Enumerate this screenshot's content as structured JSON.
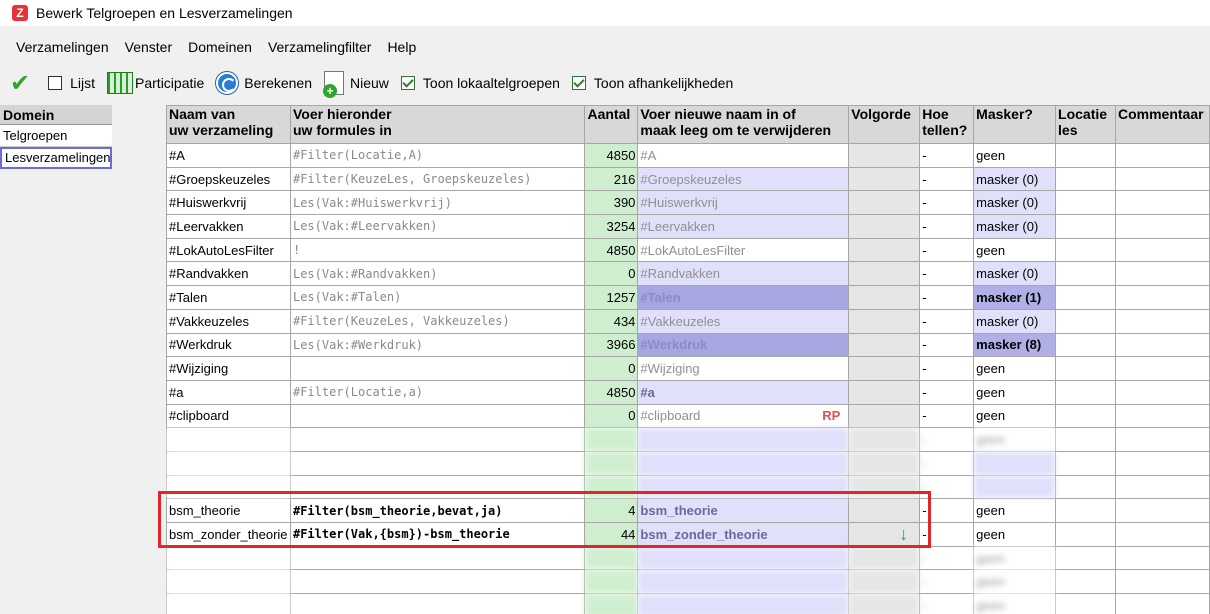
{
  "window": {
    "title": "Bewerk Telgroepen en Lesverzamelingen"
  },
  "menu": [
    "Verzamelingen",
    "Venster",
    "Domeinen",
    "Verzamelingfilter",
    "Help"
  ],
  "toolbar": {
    "lijst": "Lijst",
    "participatie": "Participatie",
    "berekenen": "Berekenen",
    "nieuw": "Nieuw",
    "toon_lokaal": "Toon lokaaltelgroepen",
    "toon_afh": "Toon afhankelijkheden",
    "lijst_checked": false,
    "toon_lokaal_checked": true,
    "toon_afh_checked": true
  },
  "domain": {
    "header": "Domein",
    "items": [
      "Telgroepen",
      "Lesverzamelingen"
    ],
    "selected": "Lesverzamelingen"
  },
  "columns": {
    "naam_1": "Naam van",
    "naam_2": "uw verzameling",
    "formule_1": "Voer hieronder",
    "formule_2": "uw formules in",
    "aantal": "Aantal",
    "nieuwe_1": "Voer nieuwe naam in of",
    "nieuwe_2": "maak leeg om te verwijderen",
    "volgorde": "Volgorde",
    "hoe_1": "Hoe",
    "hoe_2": "tellen?",
    "masker": "Masker?",
    "locatie_1": "Locatie",
    "locatie_2": "les",
    "commentaar": "Commentaar"
  },
  "rows": [
    {
      "name": "#A",
      "formula": "#Filter(Locatie,A)",
      "count": "4850",
      "newname": "#A",
      "hoe": "-",
      "masker": "geen"
    },
    {
      "name": "#Groepskeuzeles",
      "formula": "#Filter(KeuzeLes, Groepskeuzeles)",
      "count": "216",
      "newname": "#Groepskeuzeles",
      "hoe": "-",
      "masker": "masker (0)"
    },
    {
      "name": "#Huiswerkvrij",
      "formula": "Les(Vak:#Huiswerkvrij)",
      "count": "390",
      "newname": "#Huiswerkvrij",
      "hoe": "-",
      "masker": "masker (0)"
    },
    {
      "name": "#Leervakken",
      "formula": "Les(Vak:#Leervakken)",
      "count": "3254",
      "newname": "#Leervakken",
      "hoe": "-",
      "masker": "masker (0)"
    },
    {
      "name": "#LokAutoLesFilter",
      "formula": "!",
      "count": "4850",
      "newname": "#LokAutoLesFilter",
      "hoe": "-",
      "masker": "geen"
    },
    {
      "name": "#Randvakken",
      "formula": "Les(Vak:#Randvakken)",
      "count": "0",
      "newname": "#Randvakken",
      "hoe": "-",
      "masker": "masker (0)"
    },
    {
      "name": "#Talen",
      "formula": "Les(Vak:#Talen)",
      "count": "1257",
      "newname": "#Talen",
      "hoe": "-",
      "masker": "masker (1)"
    },
    {
      "name": "#Vakkeuzeles",
      "formula": "#Filter(KeuzeLes, Vakkeuzeles)",
      "count": "434",
      "newname": "#Vakkeuzeles",
      "hoe": "-",
      "masker": "masker (0)"
    },
    {
      "name": "#Werkdruk",
      "formula": "Les(Vak:#Werkdruk)",
      "count": "3966",
      "newname": "#Werkdruk",
      "hoe": "-",
      "masker": "masker (8)"
    },
    {
      "name": "#Wijziging",
      "formula": "",
      "count": "0",
      "newname": "#Wijziging",
      "hoe": "-",
      "masker": "geen"
    },
    {
      "name": "#a",
      "formula": "#Filter(Locatie,a)",
      "count": "4850",
      "newname": "#a",
      "hoe": "-",
      "masker": "geen"
    },
    {
      "name": "#clipboard",
      "formula": "",
      "count": "0",
      "newname": "#clipboard",
      "rp": "RP",
      "hoe": "-",
      "masker": "geen"
    },
    {
      "name": "",
      "formula": "",
      "count": "",
      "newname": "",
      "hoe": "-",
      "masker": "geen"
    },
    {
      "name": "",
      "formula": "",
      "count": "",
      "newname": "",
      "hoe": "-",
      "masker": ""
    },
    {
      "name": "",
      "formula": "",
      "count": "",
      "newname": "",
      "hoe": "-",
      "masker": ""
    },
    {
      "name": "bsm_theorie",
      "formula": "#Filter(bsm_theorie,bevat,ja)",
      "count": "4",
      "newname": "bsm_theorie",
      "hoe": "-",
      "masker": "geen"
    },
    {
      "name": "bsm_zonder_theorie",
      "formula": "#Filter(Vak,{bsm})-bsm_theorie",
      "count": "44",
      "newname": "bsm_zonder_theorie",
      "hoe": "-",
      "masker": "geen"
    },
    {
      "name": "",
      "formula": "",
      "count": "",
      "newname": "",
      "hoe": "-",
      "masker": "geen"
    },
    {
      "name": "",
      "formula": "",
      "count": "",
      "newname": "",
      "hoe": "-",
      "masker": "geen"
    },
    {
      "name": "",
      "formula": "",
      "count": "",
      "newname": "",
      "hoe": "-",
      "masker": "geen"
    }
  ]
}
